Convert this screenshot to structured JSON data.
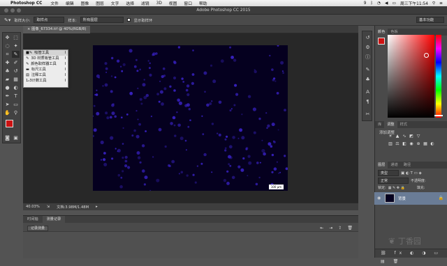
{
  "menubar": {
    "app_name": "Photoshop CC",
    "items": [
      "文件",
      "编辑",
      "图像",
      "图层",
      "文字",
      "选择",
      "滤镜",
      "3D",
      "视图",
      "窗口",
      "帮助"
    ],
    "clock": "周三下午11:54",
    "status_count": "9"
  },
  "window": {
    "title": "Adobe Photoshop CC 2015"
  },
  "options": {
    "sample_size_label": "取样大小:",
    "sample_size_value": "取样点",
    "sample_label": "样本:",
    "sample_value": "所有图层",
    "show_ring_label": "显示取样环",
    "workspace": "基本功能"
  },
  "document": {
    "tab_title": "图像_67334.tif @ 40%(RGB/8)",
    "scale_bar_text": "100 μm"
  },
  "status": {
    "zoom": "40.03%",
    "doc_size": "文档:3.98M/1.48M"
  },
  "flyout": {
    "items": [
      {
        "label": "吸管工具",
        "key": "I"
      },
      {
        "label": "3D 材质吸管工具",
        "key": "I"
      },
      {
        "label": "颜色取样器工具",
        "key": "I"
      },
      {
        "label": "标尺工具",
        "key": "I"
      },
      {
        "label": "注释工具",
        "key": "I"
      },
      {
        "label": "1₂3计数工具",
        "key": "I"
      }
    ]
  },
  "bottom_panel": {
    "tabs": [
      "时间轴",
      "测量记录"
    ],
    "record_button": "记录测量"
  },
  "right_panel": {
    "color_tabs": [
      "颜色",
      "色板"
    ],
    "adjust_tabs": [
      "库",
      "调整",
      "样式"
    ],
    "adjust_title": "添加调整",
    "layer_tabs": [
      "图层",
      "通道",
      "路径"
    ],
    "layer_kind": "类型",
    "blend_mode": "正常",
    "opacity_label": "不透明度:",
    "fill_label": "填充:",
    "lock_label": "锁定:",
    "layer_name": "背景"
  },
  "colors": {
    "foreground": "#cc1111",
    "background": "#ffffff",
    "picked": "#cc1111",
    "image_bg": "#05001f",
    "nuclei": "#3a22c8",
    "layer_selected": "#6a7c96"
  },
  "watermark": "丁香园"
}
